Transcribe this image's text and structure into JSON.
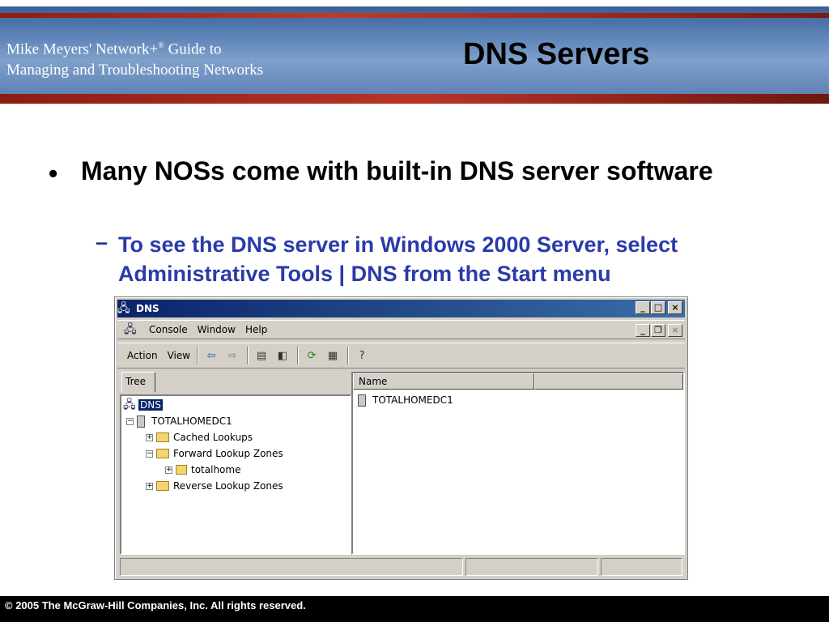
{
  "header": {
    "book_line1": "Mike Meyers' Network+",
    "book_sup": "®",
    "book_line1_suffix": " Guide to",
    "book_line2": "Managing and Troubleshooting Networks",
    "slide_title": "DNS Servers"
  },
  "bullets": {
    "main_marker": "•",
    "main_text": "Many NOSs come with built-in DNS server software",
    "sub_marker": "–",
    "sub_text": "To see the DNS server in Windows 2000 Server, select Administrative Tools | DNS from the Start menu"
  },
  "window": {
    "title": "DNS",
    "menu": [
      "Console",
      "Window",
      "Help"
    ],
    "toolbar": {
      "action": "Action",
      "view": "View"
    },
    "tree_tab": "Tree",
    "tree": {
      "root": "DNS",
      "server": "TOTALHOMEDC1",
      "cached": "Cached Lookups",
      "forward": "Forward Lookup Zones",
      "zone": "totalhome",
      "reverse": "Reverse Lookup Zones"
    },
    "list": {
      "col_name": "Name",
      "col_2": "",
      "row1": "TOTALHOMEDC1"
    }
  },
  "footer": {
    "copyright": "© 2005 The McGraw-Hill Companies, Inc.  All rights reserved."
  }
}
